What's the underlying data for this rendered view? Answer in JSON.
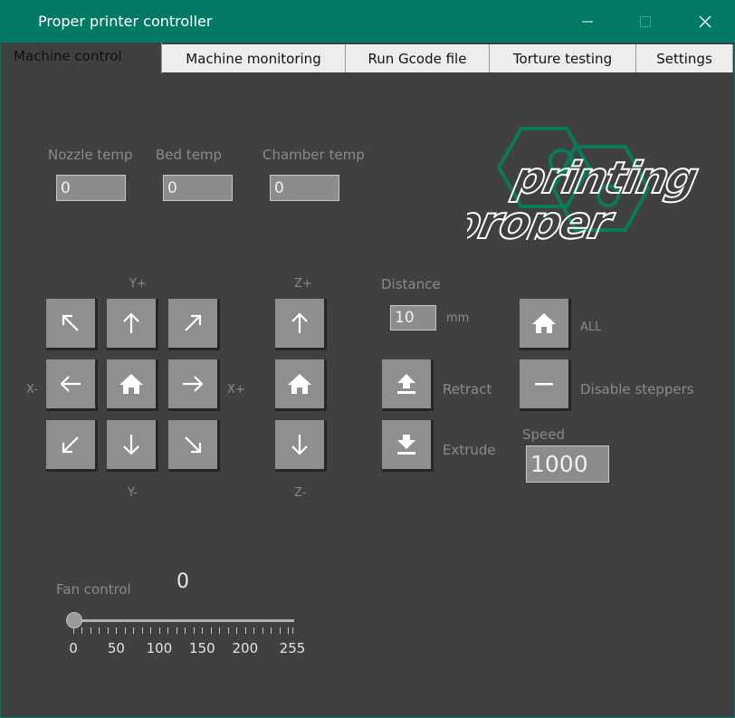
{
  "window": {
    "title": "Proper printer controller",
    "minimize": "—",
    "maximize": "☐",
    "close": "✕"
  },
  "tabs": [
    {
      "label": "Machine control",
      "active": true
    },
    {
      "label": "Machine monitoring",
      "active": false
    },
    {
      "label": "Run Gcode file",
      "active": false
    },
    {
      "label": "Torture testing",
      "active": false
    },
    {
      "label": "Settings",
      "active": false
    }
  ],
  "temps": {
    "nozzle_label": "Nozzle temp",
    "nozzle_value": "0",
    "bed_label": "Bed temp",
    "bed_value": "0",
    "chamber_label": "Chamber temp",
    "chamber_value": "0"
  },
  "logo": {
    "text_top": "printing",
    "text_bottom": "proper",
    "accent_color": "#0a7a5a"
  },
  "xy": {
    "y_plus": "Y+",
    "y_minus": "Y-",
    "x_minus": "X-",
    "x_plus": "X+",
    "buttons": [
      "arrow-up-left-icon",
      "arrow-up-icon",
      "arrow-up-right-icon",
      "arrow-left-icon",
      "home-icon",
      "arrow-right-icon",
      "arrow-down-left-icon",
      "arrow-down-icon",
      "arrow-down-right-icon"
    ]
  },
  "z": {
    "z_plus": "Z+",
    "z_minus": "Z-"
  },
  "extruder": {
    "distance_label": "Distance",
    "distance_value": "10",
    "unit": "mm",
    "retract_label": "Retract",
    "extrude_label": "Extrude"
  },
  "homing": {
    "all_label": "ALL",
    "disable_label": "Disable steppers",
    "speed_label": "Speed",
    "speed_value": "1000"
  },
  "fan": {
    "label": "Fan control",
    "value": "0",
    "ticks": [
      "0",
      "50",
      "100",
      "150",
      "200",
      "255"
    ],
    "slider_fraction": 0
  }
}
